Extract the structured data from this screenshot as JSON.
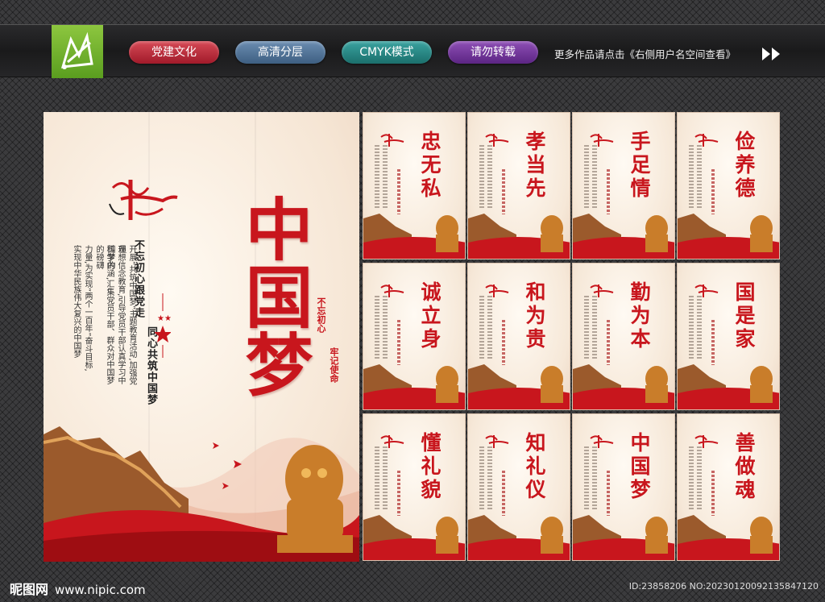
{
  "header": {
    "tags": [
      "党建文化",
      "高清分层",
      "CMYK模式",
      "请勿转载"
    ],
    "more_text": "更多作品请点击《右侧用户名空间查看》",
    "logo_icon": "pen-nib-logo-icon",
    "arrow_icon": "double-chevron-right-icon"
  },
  "big_poster": {
    "title": "中国梦",
    "slogan_1": "不忘初心跟党走",
    "slogan_2": "同心共筑中国梦",
    "body_lines": [
      "开展“共筑中国梦”主题教育活动,加强党员",
      "理想信念教育,引导党员干部认真学习中国梦的",
      "科学内涵,汇集党员干部、群众对中国梦的磅礴",
      "力量,为实现“两个一百年”奋斗目标,",
      "实现中华民族伟大复兴的中国梦"
    ],
    "seal_1": "不忘初心",
    "seal_2": "牢记使命"
  },
  "posters": [
    {
      "title": "忠无私"
    },
    {
      "title": "孝当先"
    },
    {
      "title": "手足情"
    },
    {
      "title": "俭养德"
    },
    {
      "title": "诚立身"
    },
    {
      "title": "和为贵"
    },
    {
      "title": "勤为本"
    },
    {
      "title": "国是家"
    },
    {
      "title": "懂礼貌"
    },
    {
      "title": "知礼仪"
    },
    {
      "title": "中国梦"
    },
    {
      "title": "善做魂"
    }
  ],
  "footer": {
    "brand": "昵图网",
    "site": "www.nipic.com",
    "id": "ID:23858206 NO:20230120092135847120"
  },
  "colors": {
    "accent_red": "#c8161d",
    "header_bg": "#1a1a1b",
    "logo_green": "#8dc63f"
  }
}
